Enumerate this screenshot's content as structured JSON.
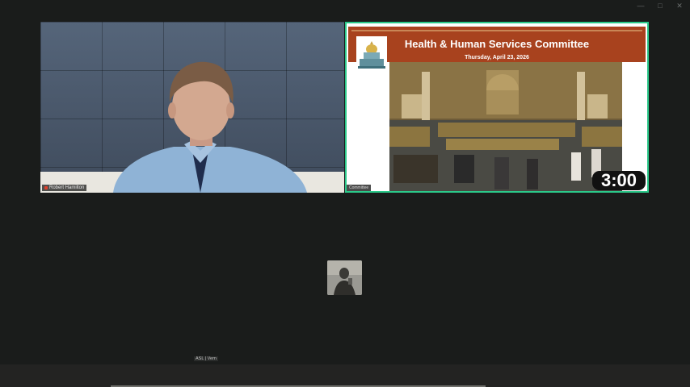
{
  "window_controls": {
    "minimize_icon": "minimize-icon",
    "maximize_icon": "maximize-icon",
    "close_icon": "close-icon"
  },
  "tiles": {
    "speaker": {
      "name": "Robert Hamilton"
    },
    "feed": {
      "banner_title": "Health & Human Services Committee",
      "banner_date": "Thursday, April 23, 2026",
      "countdown": "3:00",
      "label": "Committee"
    }
  },
  "interpreter_label": "ASL | Vern",
  "colors": {
    "active_speaker_border": "#2bc98a",
    "banner": "#a8421e",
    "background": "#1a1c1b"
  }
}
